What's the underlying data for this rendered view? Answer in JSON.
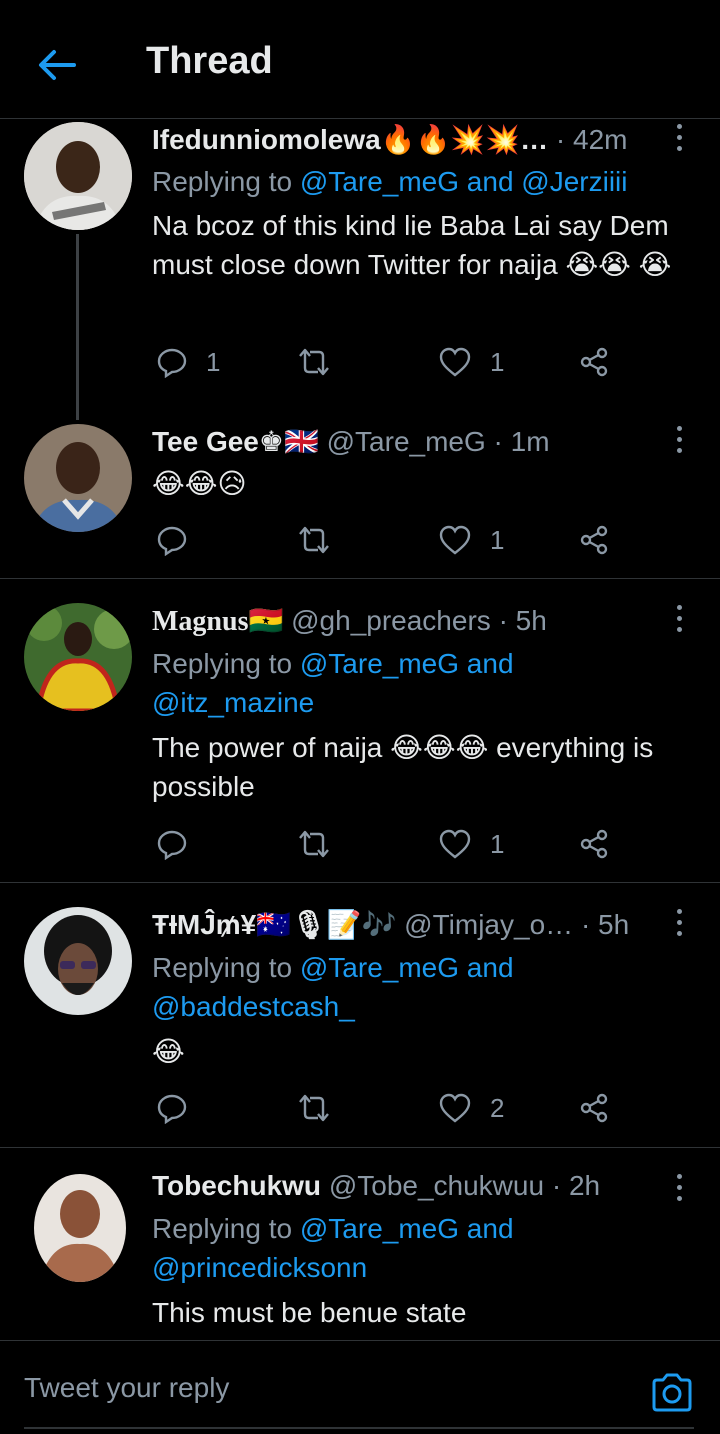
{
  "header": {
    "title": "Thread"
  },
  "tweets": [
    {
      "name": "Ifedunniomolewa🔥🔥💥💥…",
      "handle": "",
      "time": "· 42m",
      "replying_prefix": "Replying to ",
      "replying_to": "@Tare_meG and @Jerziiii",
      "replying_to_2": "",
      "body": "Na bcoz of this kind lie Baba Lai say Dem must close down Twitter for naija 😭😭 😭",
      "replies": "1",
      "retweets": "",
      "likes": "1"
    },
    {
      "name": "Tee Gee♚🇬🇧",
      "handle": "@Tare_meG",
      "time": "· 1m",
      "body": "😂😂😥",
      "replies": "",
      "retweets": "",
      "likes": "1"
    },
    {
      "name": "Magnus🇬🇭",
      "handle": "@gh_preachers",
      "time": "· 5h",
      "replying_prefix": "Replying to ",
      "replying_to": "@Tare_meG and",
      "replying_to_2": "@itz_mazine",
      "body": "The power of naija 😂😂😂 everything is possible",
      "replies": "",
      "retweets": "",
      "likes": "1"
    },
    {
      "name": "ŦƗMĴ₥¥🇦🇺🎙📝🎶",
      "handle": "@Timjay_o…",
      "time": "· 5h",
      "replying_prefix": "Replying to ",
      "replying_to": "@Tare_meG and",
      "replying_to_2": "@baddestcash_",
      "body": "😂",
      "replies": "",
      "retweets": "",
      "likes": "2"
    },
    {
      "name": "Tobechukwu",
      "handle": "@Tobe_chukwuu",
      "time": "· 2h",
      "replying_prefix": "Replying to ",
      "replying_to": "@Tare_meG and",
      "replying_to_2": "@princedicksonn",
      "body": "This must be benue state"
    }
  ],
  "reply_bar": {
    "placeholder": "Tweet your reply"
  },
  "colors": {
    "accent": "#1d9bf0",
    "muted": "#8b98a5",
    "background": "#000000"
  }
}
